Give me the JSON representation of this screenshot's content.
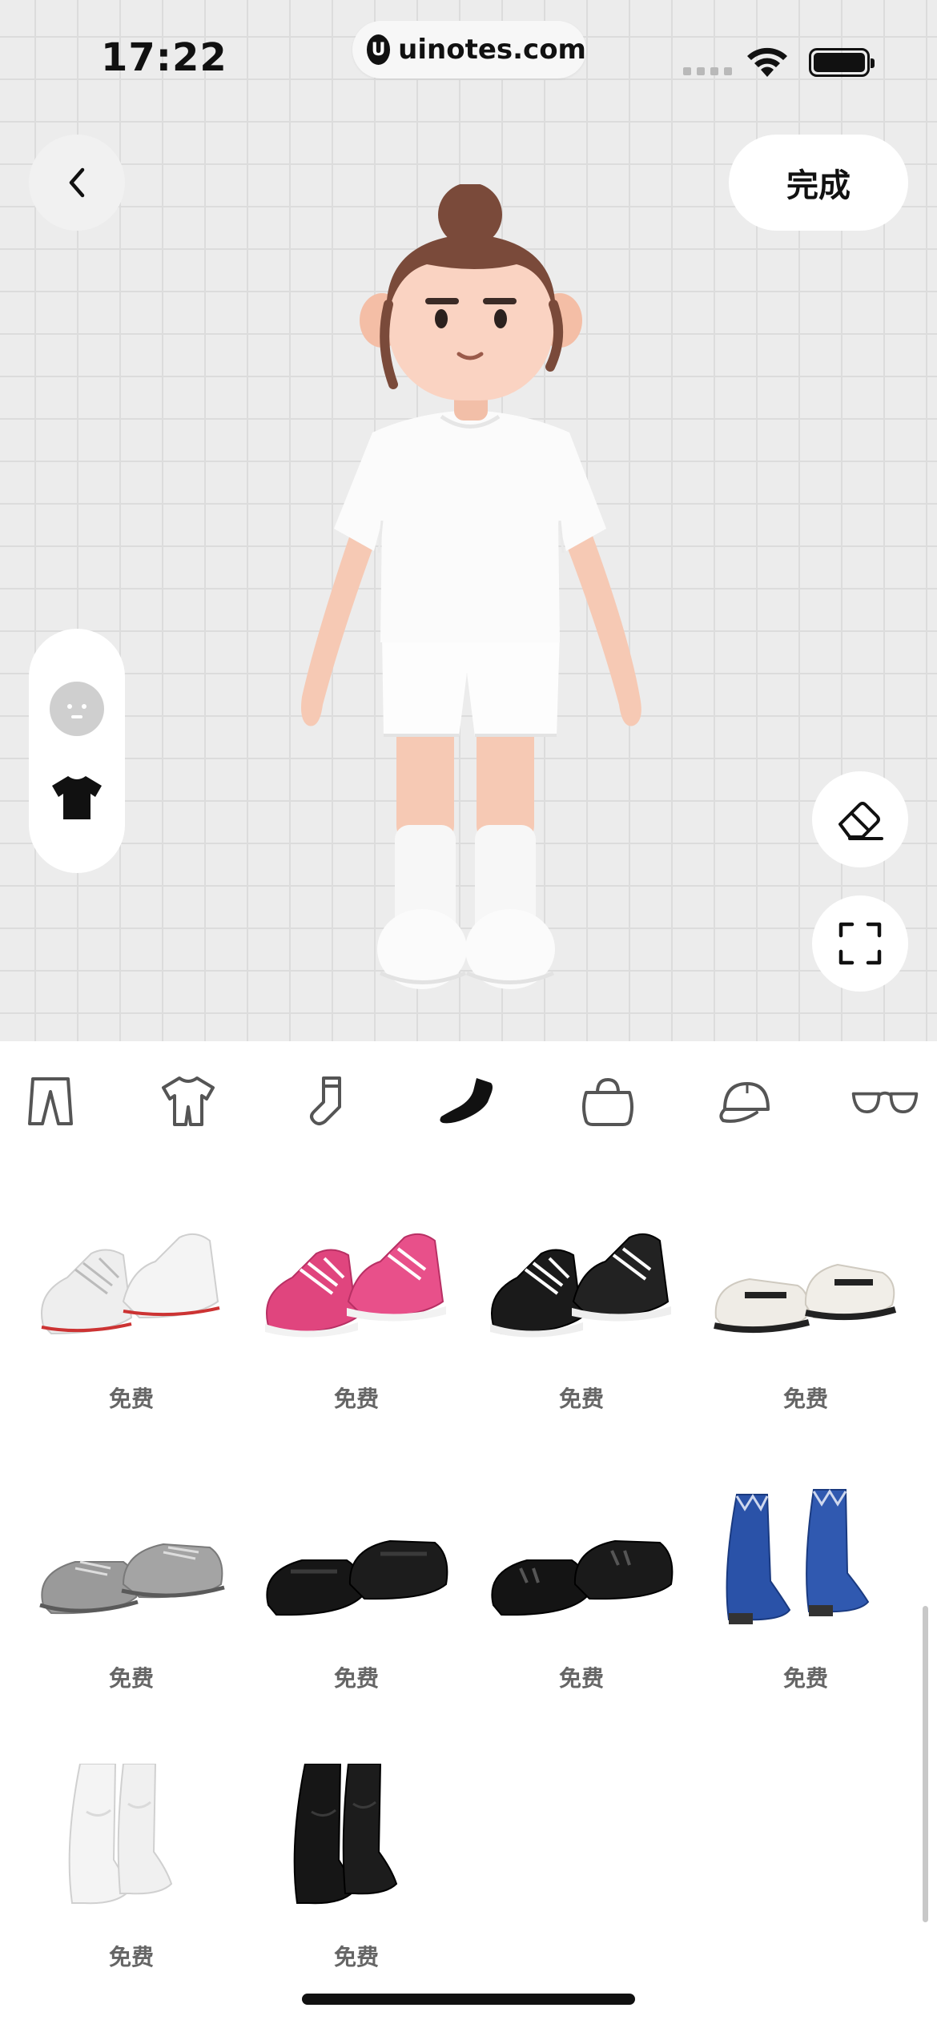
{
  "status_bar": {
    "time": "17:22",
    "url": "uinotes.com"
  },
  "header": {
    "done_label": "完成"
  },
  "categories": [
    {
      "icon": "pants-icon",
      "selected": false
    },
    {
      "icon": "outfit-icon",
      "selected": false
    },
    {
      "icon": "socks-icon",
      "selected": false
    },
    {
      "icon": "shoe-icon",
      "selected": true
    },
    {
      "icon": "bag-icon",
      "selected": false
    },
    {
      "icon": "cap-icon",
      "selected": false
    },
    {
      "icon": "glasses-icon",
      "selected": false
    }
  ],
  "items": [
    {
      "name": "white-canvas-sneakers",
      "price": "免费"
    },
    {
      "name": "pink-canvas-sneakers",
      "price": "免费"
    },
    {
      "name": "black-canvas-sneakers",
      "price": "免费"
    },
    {
      "name": "cream-mary-janes",
      "price": "免费"
    },
    {
      "name": "gray-lace-up-shoes",
      "price": "免费"
    },
    {
      "name": "black-loafers",
      "price": "免费"
    },
    {
      "name": "black-tassel-loafers",
      "price": "免费"
    },
    {
      "name": "blue-ankle-boots",
      "price": "免费"
    },
    {
      "name": "white-tall-boots",
      "price": "免费"
    },
    {
      "name": "black-tall-boots",
      "price": "免费"
    }
  ],
  "colors": {
    "stage_bg": "#ececec",
    "grid_line": "#dcdcdc",
    "price_text": "#666666",
    "selected_icon": "#111111",
    "unselected_icon": "#555555"
  }
}
